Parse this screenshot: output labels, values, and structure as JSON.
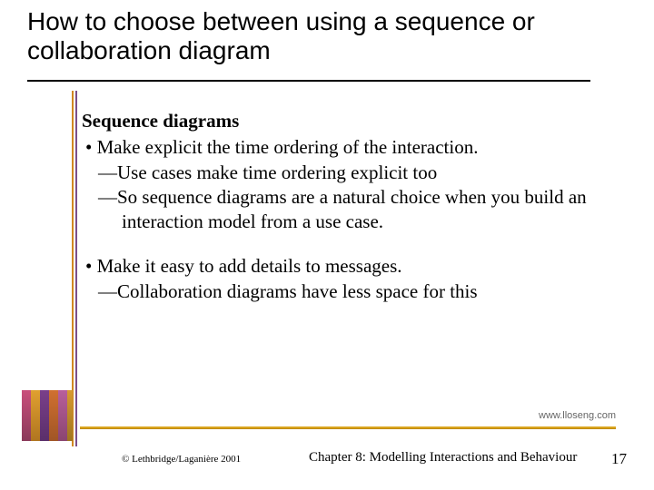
{
  "title": "How to choose between using a sequence or collaboration diagram",
  "content": {
    "heading": "Sequence diagrams",
    "bullets": [
      {
        "text": "Make explicit the time ordering of the interaction.",
        "subs": [
          "Use cases make time ordering explicit too",
          "So sequence diagrams are a natural choice when you build an interaction model from a use case."
        ]
      },
      {
        "text": "Make it easy to add details to messages.",
        "subs": [
          "Collaboration diagrams have less space for this"
        ]
      }
    ]
  },
  "url": "www.lloseng.com",
  "footer": {
    "copyright": "© Lethbridge/Laganière 2001",
    "chapter": "Chapter 8: Modelling Interactions and Behaviour",
    "page": "17"
  }
}
